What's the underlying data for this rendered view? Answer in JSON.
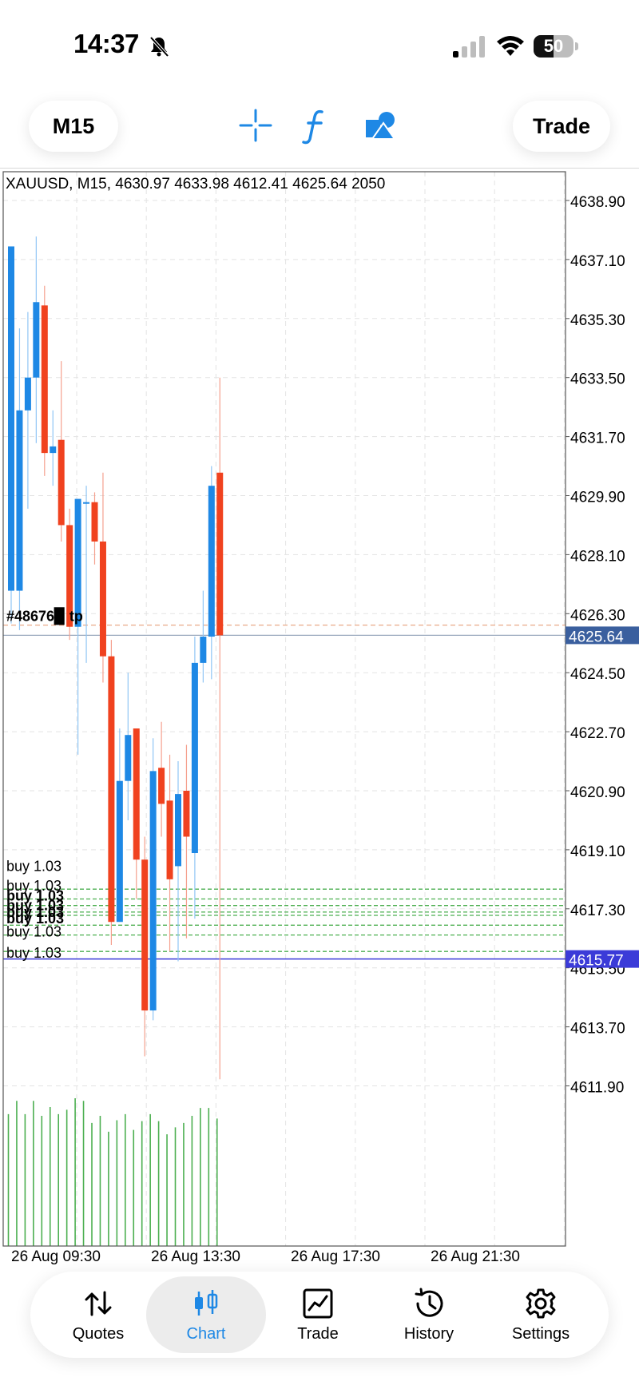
{
  "status_bar": {
    "time": "14:37",
    "battery": "50",
    "battery_level": 0.5
  },
  "toolbar": {
    "timeframe": "M15",
    "trade": "Trade"
  },
  "colors": {
    "accent": "#1e88e5",
    "bull": "#1e88e5",
    "bear": "#f0421f",
    "position_line": "#3b3bd8",
    "buy_level": "#4caf50",
    "tp_line": "#e8a07a",
    "price_label": "#3a5f9e"
  },
  "chart": {
    "header": "XAUUSD, M15, 4630.97 4633.98 4612.41 4625.64 2050",
    "price_axis": [
      "4638.90",
      "4637.10",
      "4635.30",
      "4633.50",
      "4631.70",
      "4629.90",
      "4628.10",
      "4626.30",
      "4624.50",
      "4622.70",
      "4620.90",
      "4619.10",
      "4617.30",
      "4615.50",
      "4613.70",
      "4611.90"
    ],
    "time_axis": [
      "26 Aug 09:30",
      "26 Aug 13:30",
      "26 Aug 17:30",
      "26 Aug 21:30"
    ],
    "current_price": "4625.64",
    "position_price": "4615.77",
    "tp_label": "#48676▉ tp",
    "buy_labels": [
      "buy 1.03",
      "buy 1.03",
      "buy 1.03",
      "buy 1.03",
      "buy 1.03",
      "buy 1.03",
      "buy 1.03",
      "buy 1.03"
    ]
  },
  "chart_data": {
    "type": "candlestick",
    "symbol": "XAUUSD",
    "timeframe": "M15",
    "ylim": [
      4611.0,
      4639.4
    ],
    "candles": [
      {
        "o": 4627.0,
        "h": 4636.7,
        "l": 4626.0,
        "c": 4637.5
      },
      {
        "o": 4627.0,
        "h": 4635.0,
        "l": 4625.8,
        "c": 4632.5
      },
      {
        "o": 4632.5,
        "h": 4635.5,
        "l": 4629.5,
        "c": 4633.5
      },
      {
        "o": 4633.5,
        "h": 4637.8,
        "l": 4631.5,
        "c": 4635.8
      },
      {
        "o": 4635.7,
        "h": 4636.3,
        "l": 4630.5,
        "c": 4631.2
      },
      {
        "o": 4631.2,
        "h": 4632.5,
        "l": 4630.2,
        "c": 4631.4
      },
      {
        "o": 4631.6,
        "h": 4634.0,
        "l": 4628.5,
        "c": 4629.0
      },
      {
        "o": 4629.0,
        "h": 4629.5,
        "l": 4625.5,
        "c": 4625.9
      },
      {
        "o": 4625.9,
        "h": 4629.8,
        "l": 4622.0,
        "c": 4629.8
      },
      {
        "o": 4629.7,
        "h": 4630.2,
        "l": 4624.8,
        "c": 4629.7
      },
      {
        "o": 4629.7,
        "h": 4630.0,
        "l": 4627.8,
        "c": 4628.5
      },
      {
        "o": 4628.5,
        "h": 4630.6,
        "l": 4624.2,
        "c": 4625.0
      },
      {
        "o": 4625.0,
        "h": 4625.5,
        "l": 4616.2,
        "c": 4616.9
      },
      {
        "o": 4616.9,
        "h": 4622.8,
        "l": 4616.9,
        "c": 4621.2
      },
      {
        "o": 4621.2,
        "h": 4624.5,
        "l": 4620.0,
        "c": 4622.6
      },
      {
        "o": 4622.8,
        "h": 4622.8,
        "l": 4617.6,
        "c": 4618.8
      },
      {
        "o": 4618.8,
        "h": 4619.5,
        "l": 4612.8,
        "c": 4614.2
      },
      {
        "o": 4614.2,
        "h": 4622.5,
        "l": 4613.9,
        "c": 4621.5
      },
      {
        "o": 4621.6,
        "h": 4623.0,
        "l": 4619.5,
        "c": 4620.5
      },
      {
        "o": 4620.6,
        "h": 4622.0,
        "l": 4616.0,
        "c": 4618.2
      },
      {
        "o": 4618.6,
        "h": 4621.8,
        "l": 4615.7,
        "c": 4620.8
      },
      {
        "o": 4620.9,
        "h": 4622.3,
        "l": 4616.4,
        "c": 4619.5
      },
      {
        "o": 4619.0,
        "h": 4625.6,
        "l": 4617.0,
        "c": 4624.8
      },
      {
        "o": 4624.8,
        "h": 4627.0,
        "l": 4624.2,
        "c": 4625.6
      },
      {
        "o": 4625.6,
        "h": 4630.8,
        "l": 4624.3,
        "c": 4630.2
      },
      {
        "o": 4630.6,
        "h": 4633.5,
        "l": 4612.1,
        "c": 4625.64
      }
    ],
    "volumes": [
      150,
      165,
      150,
      165,
      148,
      158,
      150,
      155,
      168,
      165,
      140,
      148,
      130,
      143,
      150,
      132,
      142,
      150,
      142,
      127,
      135,
      140,
      148,
      157,
      157,
      145
    ],
    "buy_levels": [
      4617.9,
      4617.6,
      4617.4,
      4617.2,
      4617.1,
      4616.8,
      4616.5,
      4616.0
    ],
    "tp_level": 4625.95,
    "position_level": 4615.77,
    "current_level": 4625.64
  },
  "bottom_nav": {
    "items": [
      {
        "label": "Quotes",
        "icon": "quotes-arrows-icon",
        "active": false
      },
      {
        "label": "Chart",
        "icon": "candlestick-icon",
        "active": true
      },
      {
        "label": "Trade",
        "icon": "trade-chart-icon",
        "active": false
      },
      {
        "label": "History",
        "icon": "history-clock-icon",
        "active": false
      },
      {
        "label": "Settings",
        "icon": "settings-gear-icon",
        "active": false
      }
    ]
  }
}
